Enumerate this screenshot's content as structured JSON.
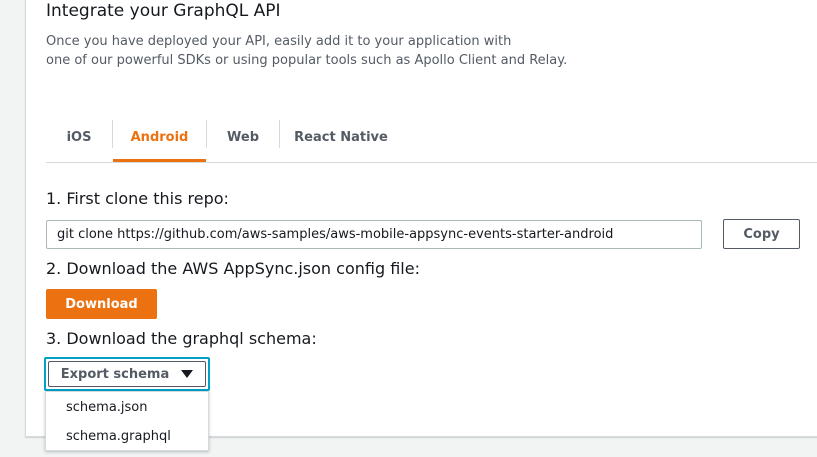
{
  "header": {
    "title": "Integrate your GraphQL API",
    "description_line1": "Once you have deployed your API, easily add it to your application with",
    "description_line2": "one of our powerful SDKs or using popular tools such as Apollo Client and Relay."
  },
  "tabs": [
    {
      "label": "iOS",
      "active": false
    },
    {
      "label": "Android",
      "active": true
    },
    {
      "label": "Web",
      "active": false
    },
    {
      "label": "React Native",
      "active": false
    }
  ],
  "steps": {
    "step1_label": "1. First clone this repo:",
    "repo_command": "git clone https://github.com/aws-samples/aws-mobile-appsync-events-starter-android",
    "copy_label": "Copy",
    "step2_label": "2. Download the AWS AppSync.json config file:",
    "download_label": "Download",
    "step3_label": "3. Download the graphql schema:",
    "export_label": "Export schema",
    "export_options": [
      "schema.json",
      "schema.graphql"
    ]
  },
  "colors": {
    "accent": "#ec7211",
    "focus": "#00a1c9",
    "text": "#16191f",
    "muted": "#545b64",
    "border": "#d5dbdb"
  }
}
